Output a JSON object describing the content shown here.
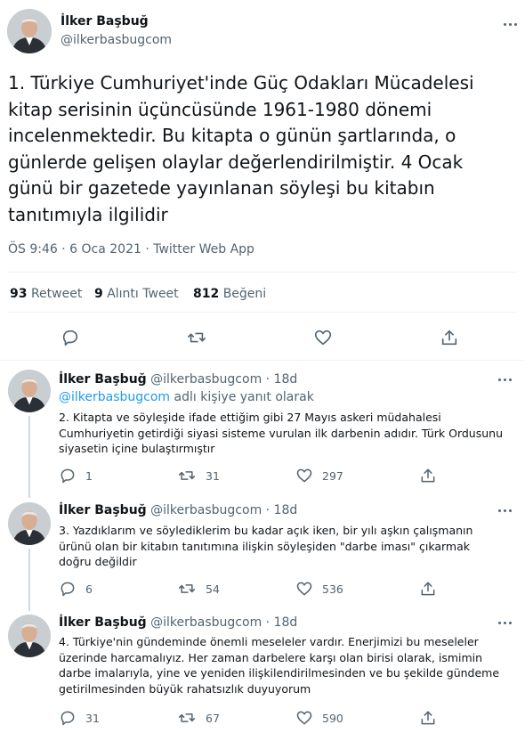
{
  "main": {
    "author_name": "İlker Başbuğ",
    "author_handle": "@ilkerbasbugcom",
    "text": "1. Türkiye Cumhuriyet'inde Güç Odakları Mücadelesi kitap serisinin üçüncüsünde 1961-1980 dönemi incelenmektedir. Bu kitapta o günün şartlarında, o günlerde gelişen olaylar değerlendirilmiştir. 4 Ocak günü bir gazetede yayınlanan söyleşi bu kitabın tanıtımıyla ilgilidir",
    "meta": "ÖS 9:46 · 6 Oca 2021 · Twitter Web App",
    "retweets_count": "93",
    "retweets_label": "Retweet",
    "quotes_count": "9",
    "quotes_label": "Alıntı Tweet",
    "likes_count": "812",
    "likes_label": "Beğeni"
  },
  "replies": [
    {
      "name": "İlker Başbuğ",
      "handle": "@ilkerbasbugcom",
      "time": "· 18d",
      "reply_to_handle": "@ilkerbasbugcom",
      "reply_to_suffix": " adlı kişiye yanıt olarak",
      "text": "2. Kitapta ve söyleşide ifade ettiğim gibi 27 Mayıs askeri müdahalesi Cumhuriyetin getirdiği siyasi sisteme vurulan ilk darbenin adıdır.  Türk Ordusunu siyasetin içine bulaştırmıştır",
      "replies": "1",
      "retweets": "31",
      "likes": "297"
    },
    {
      "name": "İlker Başbuğ",
      "handle": "@ilkerbasbugcom",
      "time": "· 18d",
      "text": "3. Yazdıklarım ve söylediklerim bu kadar açık iken, bir yılı aşkın çalışmanın ürünü olan bir kitabın tanıtımına ilişkin söyleşiden \"darbe iması\" çıkarmak doğru değildir",
      "replies": "6",
      "retweets": "54",
      "likes": "536"
    },
    {
      "name": "İlker Başbuğ",
      "handle": "@ilkerbasbugcom",
      "time": "· 18d",
      "text": "4. Türkiye'nin gündeminde önemli meseleler vardır. Enerjimizi bu meseleler üzerinde harcamalıyız. Her zaman darbelere karşı olan birisi olarak, ismimin darbe imalarıyla, yine ve yeniden ilişkilendirilmesinden ve bu şekilde gündeme getirilmesinden büyük rahatsızlık duyuyorum",
      "replies": "31",
      "retweets": "67",
      "likes": "590"
    }
  ],
  "icons": {
    "reply": "reply-icon",
    "retweet": "retweet-icon",
    "like": "heart-icon",
    "share": "share-icon",
    "more": "more-options-icon"
  },
  "colors": {
    "link": "#1d9bf0",
    "secondary_text": "#536471",
    "thread_line": "#cfd9de"
  }
}
